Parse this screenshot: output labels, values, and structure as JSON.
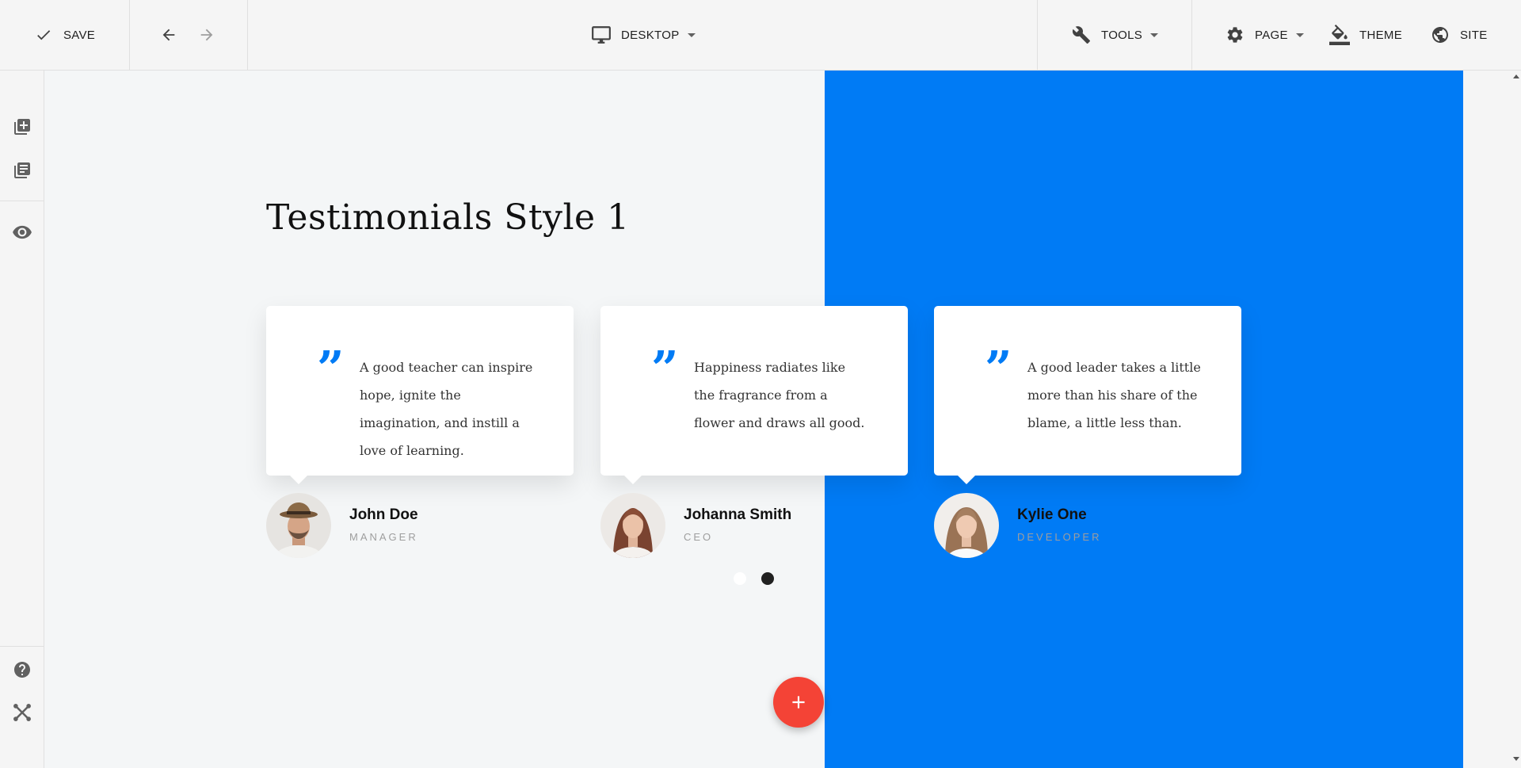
{
  "colors": {
    "accent": "#007bf5",
    "fab": "#f44336",
    "dot_active": "#212121",
    "dot_inactive": "#ffffff"
  },
  "toolbar": {
    "save_label": "SAVE",
    "device_label": "DESKTOP",
    "tools_label": "TOOLS",
    "page_label": "PAGE",
    "theme_label": "THEME",
    "site_label": "SITE",
    "icons": [
      "check-icon",
      "undo-arrow-icon",
      "redo-arrow-icon",
      "desktop-monitor-icon",
      "wrench-icon",
      "gear-icon",
      "paint-bucket-icon",
      "globe-icon"
    ]
  },
  "sidebar": {
    "icons": [
      "add-block-icon",
      "library-icon",
      "preview-eye-icon",
      "help-icon",
      "joomla-logo-icon"
    ]
  },
  "main": {
    "title": "Testimonials Style 1",
    "testimonials": [
      {
        "quote": "A good teacher can inspire hope, ignite the imagination, and instill a love of learning.",
        "name": "John Doe",
        "role": "MANAGER"
      },
      {
        "quote": "Happiness radiates like the fragrance from a flower and draws all good.",
        "name": "Johanna Smith",
        "role": "CEO"
      },
      {
        "quote": "A good leader takes a little more than his share of the blame, a little less than.",
        "name": "Kylie One",
        "role": "DEVELOPER"
      }
    ],
    "quote_glyph": "”",
    "pagination": {
      "pages": 2,
      "active": 2
    },
    "fab_symbol": "+"
  }
}
